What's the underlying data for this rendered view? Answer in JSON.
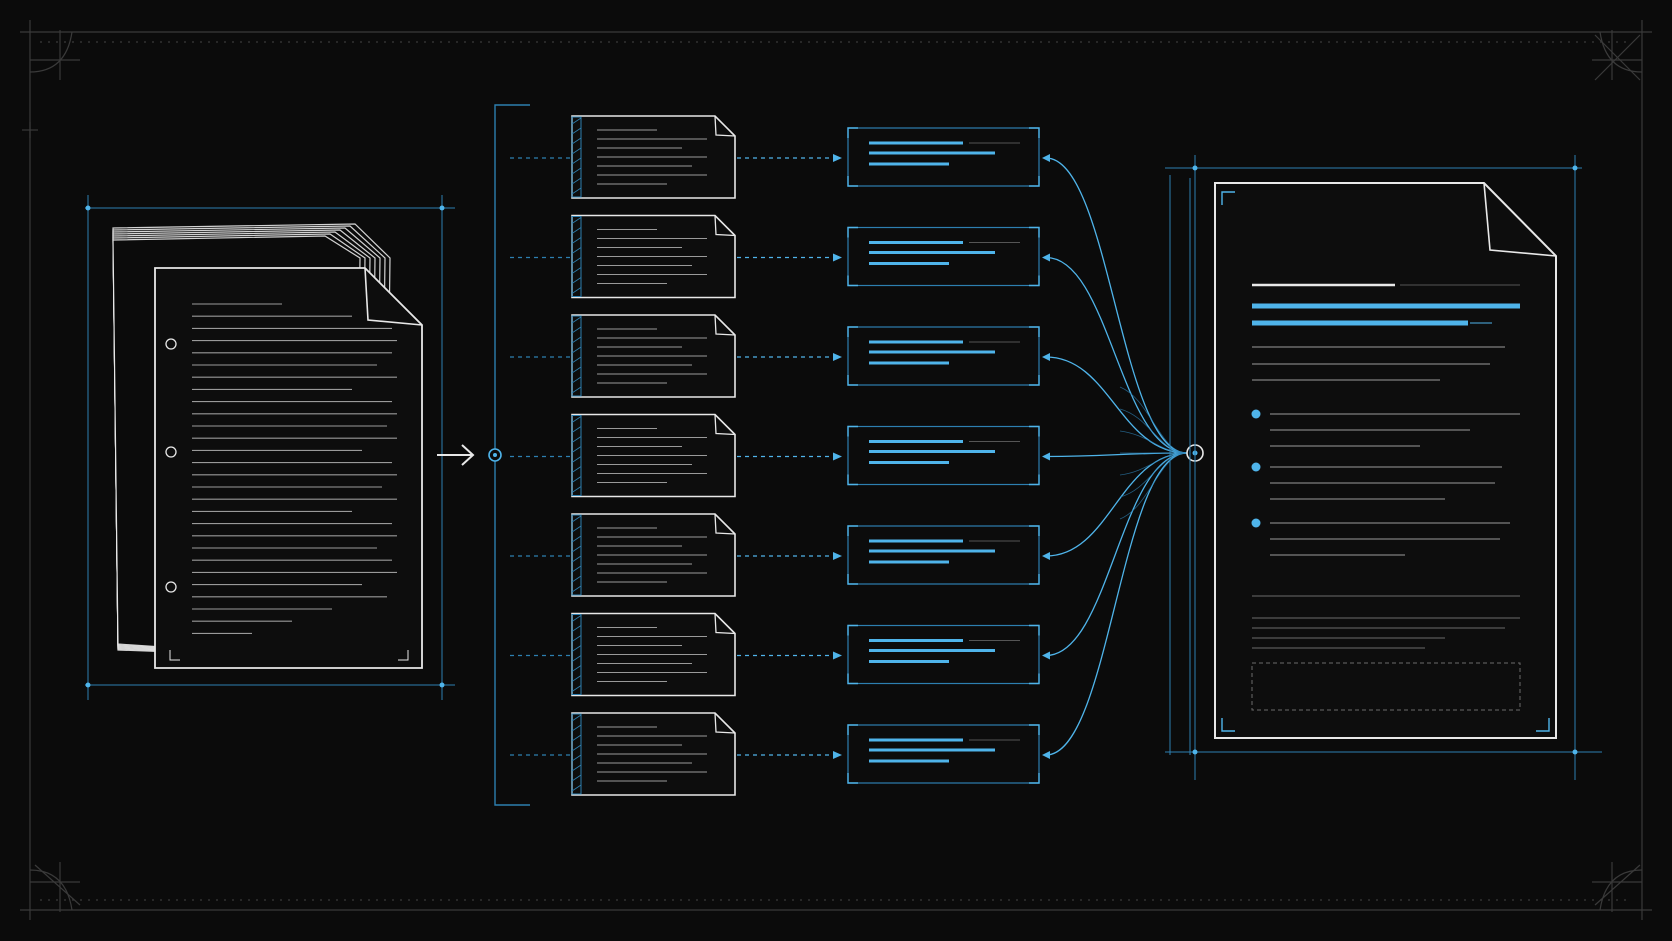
{
  "diagram": {
    "description_none": "",
    "chunk_count": 7,
    "colors": {
      "background": "#0b0b0b",
      "frame": "#3a3a3a",
      "sketch": "#e8e8e8",
      "text_line": "#9a9a9a",
      "accent": "#4fb4ea",
      "accent_dim": "#2d7fb0"
    },
    "icons": {
      "source": "stacked-document-icon",
      "chunk": "document-chunk-icon",
      "summary": "summary-card-icon",
      "merge": "merge-node-icon",
      "output": "final-document-icon"
    }
  }
}
